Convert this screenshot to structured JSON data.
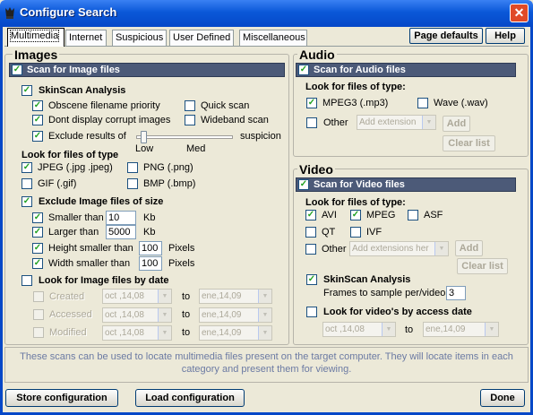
{
  "window": {
    "title": "Configure Search",
    "close": "✕"
  },
  "tabs": [
    "Multimedia",
    "Internet",
    "Suspicious",
    "User Defined",
    "Miscellaneous"
  ],
  "toolbar": {
    "page_defaults": "Page defaults",
    "help": "Help"
  },
  "images": {
    "title": "Images",
    "scan_label": "Scan for Image files",
    "skinscan": {
      "label": "SkinScan Analysis",
      "obscene": "Obscene filename priority",
      "quick": "Quick scan",
      "corrupt": "Dont display corrupt images",
      "wideband": "Wideband scan",
      "exclude": "Exclude results of",
      "suspicion": "suspicion",
      "low": "Low",
      "med": "Med",
      "level": 0.05
    },
    "types_label": "Look for files of type",
    "types": {
      "jpeg": "JPEG  (.jpg .jpeg)",
      "png": "PNG (.png)",
      "gif": "GIF  (.gif)",
      "bmp": "BMP (.bmp)"
    },
    "size": {
      "label": "Exclude Image files of size",
      "smaller": "Smaller than",
      "smaller_val": "10",
      "smaller_unit": "Kb",
      "larger": "Larger than",
      "larger_val": "5000",
      "larger_unit": "Kb",
      "height": "Height smaller than",
      "height_val": "100",
      "height_unit": "Pixels",
      "width": "Width smaller than",
      "width_val": "100",
      "width_unit": "Pixels"
    },
    "date": {
      "label": "Look for Image files by date",
      "to": "to",
      "rows": [
        {
          "label": "Created",
          "from": "oct ,14,08",
          "until": "ene,14,09"
        },
        {
          "label": "Accessed",
          "from": "oct ,14,08",
          "until": "ene,14,09"
        },
        {
          "label": "Modified",
          "from": "oct ,14,08",
          "until": "ene,14,09"
        }
      ]
    }
  },
  "audio": {
    "title": "Audio",
    "scan_label": "Scan for Audio files",
    "types_label": "Look for files of type:",
    "mp3": "MPEG3  (.mp3)",
    "wav": "Wave  (.wav)",
    "other": "Other",
    "ext_placeholder": "Add extension",
    "add": "Add",
    "clear": "Clear list"
  },
  "video": {
    "title": "Video",
    "scan_label": "Scan for Video files",
    "types_label": "Look for files of type:",
    "avi": "AVI",
    "mpeg": "MPEG",
    "asf": "ASF",
    "qt": "QT",
    "ivf": "IVF",
    "other": "Other",
    "ext_placeholder": "Add extensions her",
    "add": "Add",
    "clear": "Clear list",
    "skinscan": "SkinScan Analysis",
    "frames_label": "Frames to sample per/video",
    "frames_val": "3",
    "access_label": "Look for video's by access date",
    "from": "oct ,14,08",
    "to": "to",
    "until": "ene,14,09"
  },
  "info_text": "These scans can be used to locate multimedia files present on the target computer. They will locate items in each category and present them for viewing.",
  "buttons": {
    "store": "Store configuration",
    "load": "Load configuration",
    "done": "Done"
  },
  "check": "✓",
  "colors": {
    "titlebar": "#0a58d8",
    "header_dark": "#4c5a78",
    "info_text": "#6b7aa3"
  }
}
